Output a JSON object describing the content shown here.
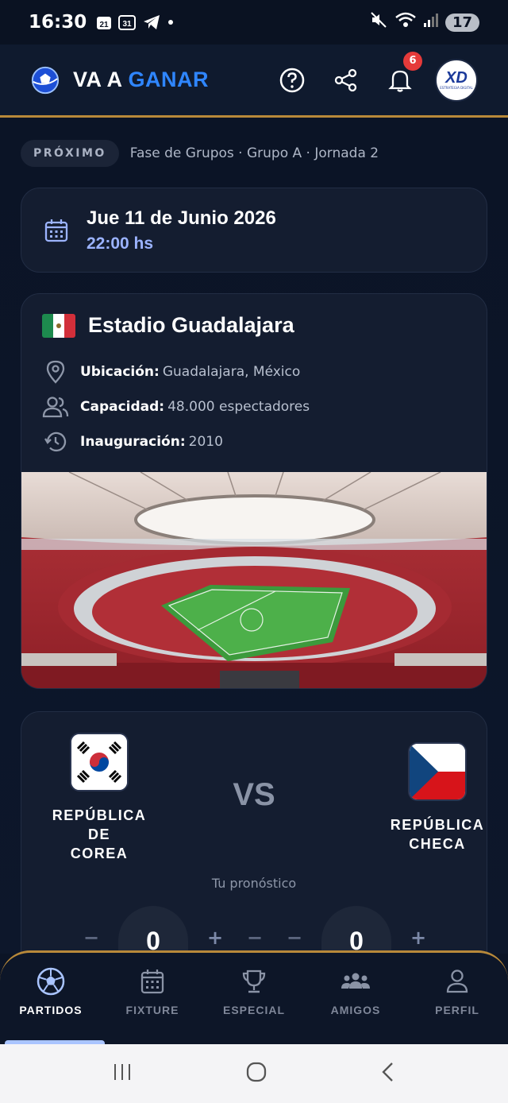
{
  "status_bar": {
    "time": "16:30",
    "notif_icons": [
      "calendar-21-icon",
      "calendar-31-icon",
      "telegram-icon"
    ],
    "calendar_a": "21",
    "calendar_b": "31",
    "battery": "17"
  },
  "app_bar": {
    "brand_white": "VA A",
    "brand_blue": "GANAR",
    "notification_count": "6",
    "avatar_text": "XD",
    "avatar_subtext": "ESTRATEGIA DIGITAL"
  },
  "match_info": {
    "status_pill": "PRÓXIMO",
    "phase": "Fase de Grupos · Grupo A · Jornada 2",
    "date": "Jue 11 de Junio 2026",
    "time": "22:00 hs"
  },
  "stadium": {
    "name": "Estadio Guadalajara",
    "location_label": "Ubicación:",
    "location_value": "Guadalajara, México",
    "capacity_label": "Capacidad:",
    "capacity_value": "48.000 espectadores",
    "inauguration_label": "Inauguración:",
    "inauguration_value": "2010"
  },
  "match": {
    "home_line1": "REPÚBLICA",
    "home_line2": "DE",
    "home_line3": "COREA",
    "away_line1": "REPÚBLICA",
    "away_line2": "CHECA",
    "vs": "VS",
    "prediction_label": "Tu pronóstico",
    "home_score": "0",
    "away_score": "0",
    "minus": "−",
    "plus": "+"
  },
  "bottom_nav": {
    "items": [
      {
        "label": "PARTIDOS",
        "icon": "soccer-ball-icon",
        "active": true
      },
      {
        "label": "FIXTURE",
        "icon": "calendar-icon",
        "active": false
      },
      {
        "label": "ESPECIAL",
        "icon": "trophy-icon",
        "active": false
      },
      {
        "label": "AMIGOS",
        "icon": "friends-icon",
        "active": false
      },
      {
        "label": "PERFIL",
        "icon": "user-icon",
        "active": false
      }
    ]
  },
  "colors": {
    "background": "#0b1426",
    "accent_gold": "#b8893a",
    "brand_blue": "#2f86ff",
    "date_time_blue": "#9bb3ff",
    "badge_red": "#e53a3a"
  }
}
